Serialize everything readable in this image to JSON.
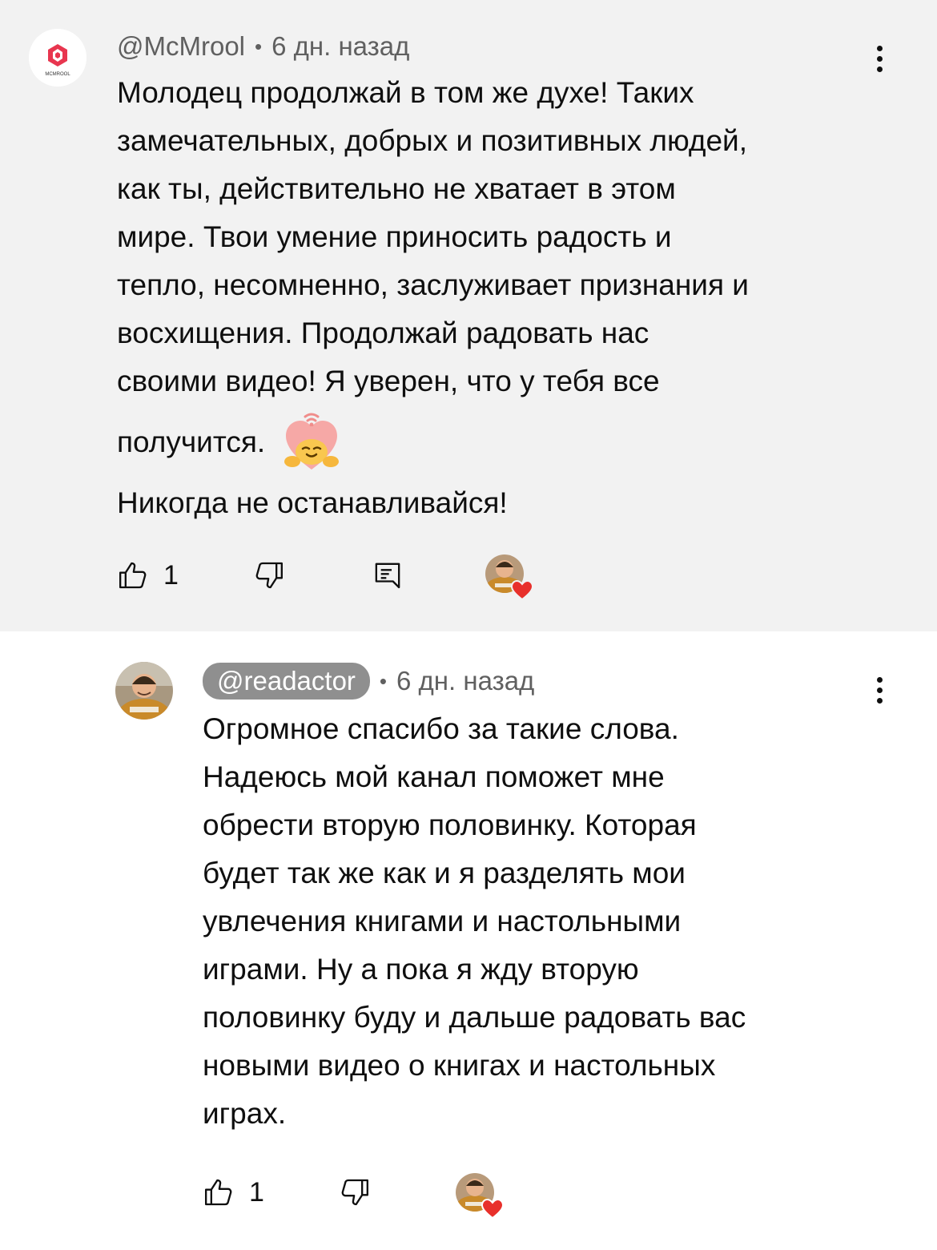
{
  "comments": [
    {
      "handle": "@McMrool",
      "time": "6 дн. назад",
      "avatar_text": "MCMROOL",
      "lines": [
        "Молодец продолжай в том же духе! Таких",
        "замечательных, добрых и позитивных людей,",
        "как ты, действительно не хватает в этом",
        "мире. Твои умение приносить радость и",
        "тепло, несомненно, заслуживает признания и",
        "восхищения. Продолжай радовать нас",
        "своими видео! Я уверен, что у тебя все",
        "получится.",
        "Никогда не останавливайся!"
      ],
      "emoji": "smiling-face-with-open-hands",
      "likes": "1",
      "has_reply_button": true,
      "creator_heart": true
    },
    {
      "handle": "@readactor",
      "time": "6 дн. назад",
      "lines": [
        "Огромное спасибо за такие слова.",
        "Надеюсь мой канал поможет мне",
        "обрести вторую половинку. Которая",
        "будет так же как и я разделять мои",
        "увлечения книгами и настольными",
        "играми. Ну а пока я жду вторую",
        "половинку буду и дальше радовать вас",
        "новыми видео о книгах и настольных",
        "играх."
      ],
      "likes": "1",
      "has_reply_button": false,
      "creator_heart": true
    }
  ],
  "colors": {
    "highlight_bg": "#f2f2f2",
    "meta_text": "#606060",
    "pill_bg": "#8f8f8f",
    "heart": "#e8302b",
    "logo_red": "#e8364f"
  }
}
